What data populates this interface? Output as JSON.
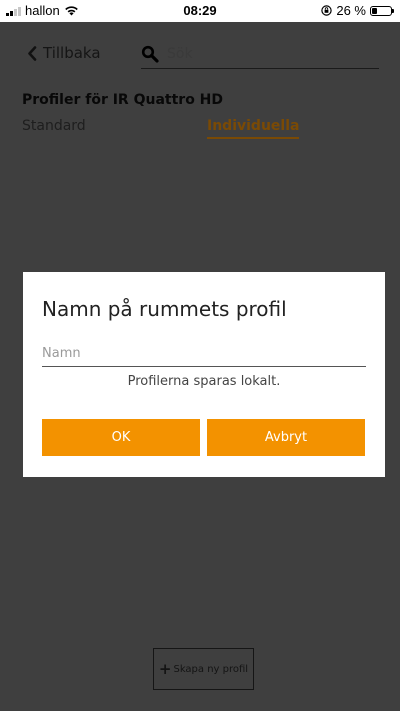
{
  "status_bar": {
    "carrier": "hallon",
    "time": "08:29",
    "battery_text": "26 %",
    "battery_level": 0.26
  },
  "header": {
    "back_label": "Tillbaka",
    "search_placeholder": "Sök"
  },
  "profiles": {
    "title": "Profiler för IR Quattro HD",
    "tabs": [
      {
        "label": "Standard",
        "active": false
      },
      {
        "label": "Individuella",
        "active": true
      }
    ]
  },
  "dialog": {
    "title": "Namn på rummets profil",
    "name_placeholder": "Namn",
    "name_value": "",
    "hint": "Profilerna sparas lokalt.",
    "ok_label": "OK",
    "cancel_label": "Avbryt"
  },
  "footer": {
    "create_label": "Skapa ny profil"
  },
  "colors": {
    "accent": "#f39200",
    "active_tab": "#7a4a05",
    "overlay": "#3f3f3f",
    "dialog_bg": "#ffffff"
  },
  "icons": {
    "back": "chevron-left-icon",
    "search": "search-icon",
    "wifi": "wifi-icon",
    "lock": "rotation-lock-icon",
    "battery": "battery-icon",
    "plus": "plus-icon"
  }
}
